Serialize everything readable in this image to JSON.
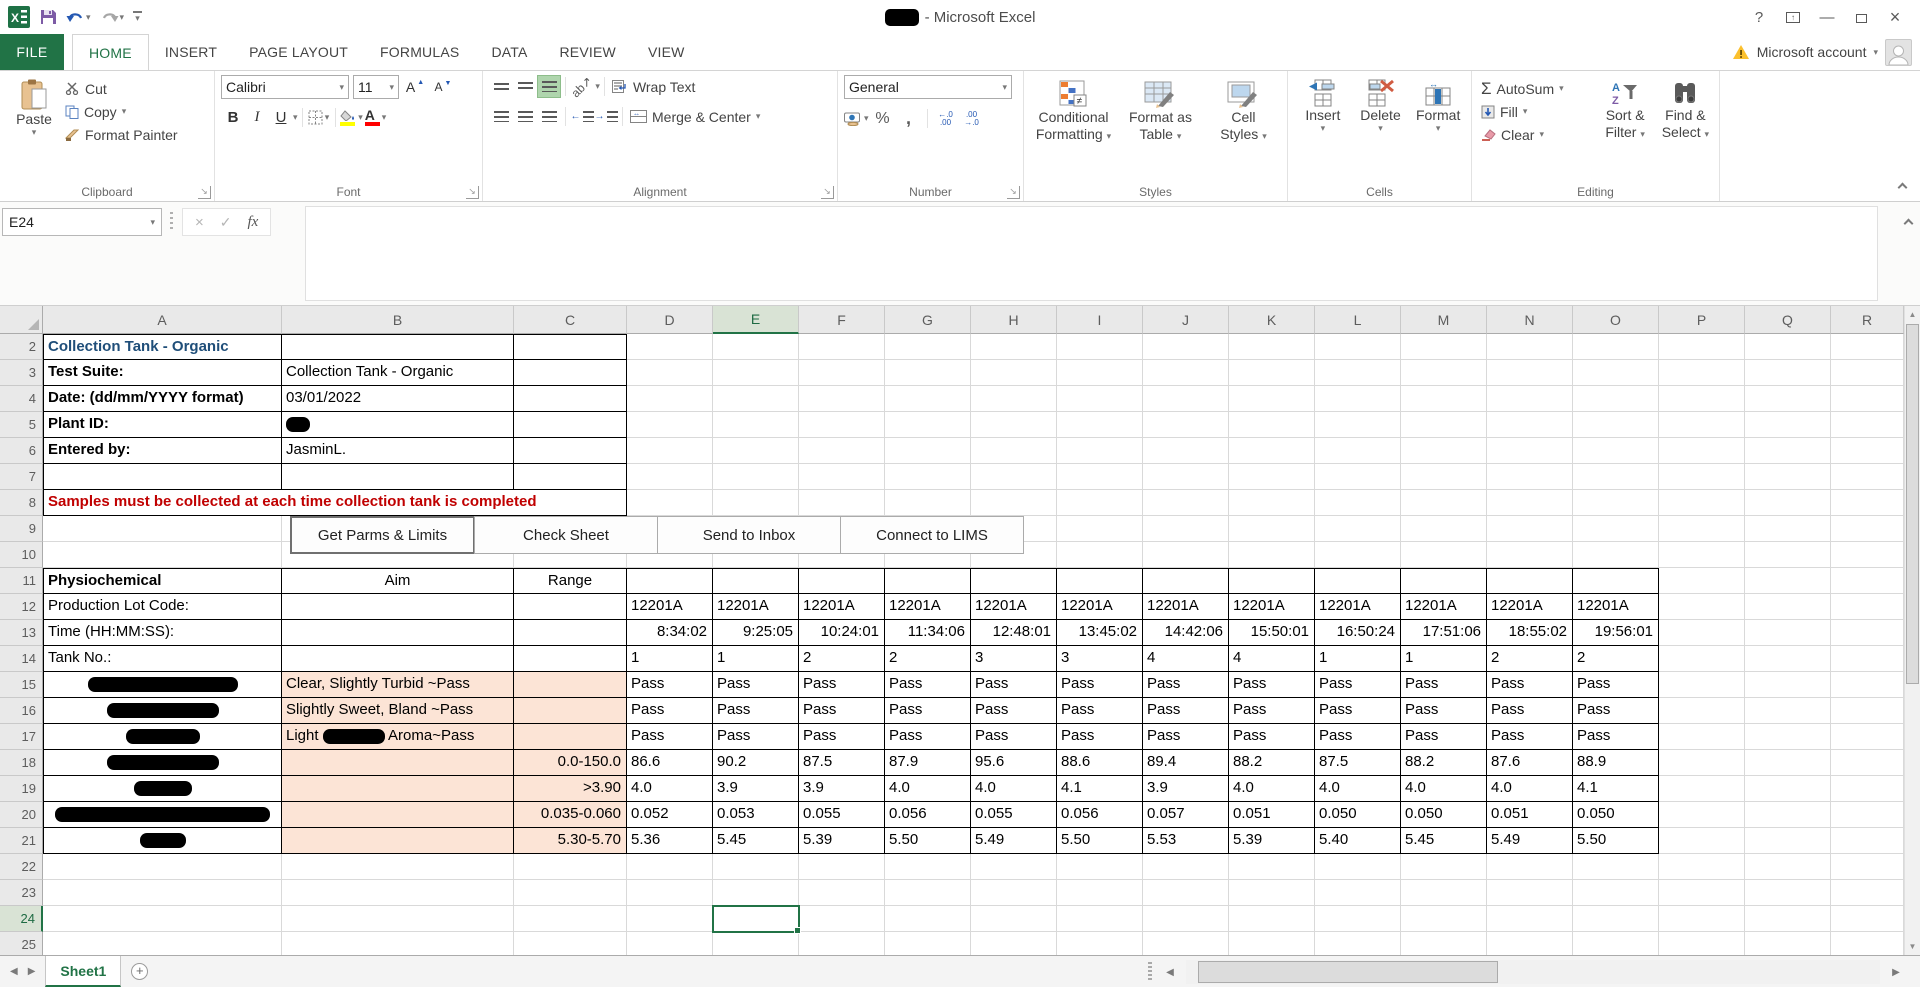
{
  "colors": {
    "accent_green": "#217346",
    "tan_fill": "#FCE4D6",
    "warning_red": "#C00000",
    "title_blue": "#1F4E79"
  },
  "window": {
    "title_suffix": " - Microsoft Excel",
    "title_redacted_width": 34
  },
  "ribbon": {
    "file_tab": "FILE",
    "tabs": [
      "HOME",
      "INSERT",
      "PAGE LAYOUT",
      "FORMULAS",
      "DATA",
      "REVIEW",
      "VIEW"
    ],
    "active_tab": "HOME",
    "account_label": "Microsoft account",
    "groups": {
      "clipboard": {
        "label": "Clipboard",
        "paste": "Paste",
        "cut": "Cut",
        "copy": "Copy",
        "format_painter": "Format Painter"
      },
      "font": {
        "label": "Font",
        "family": "Calibri",
        "size": "11",
        "bold": "B",
        "italic": "I",
        "underline": "U"
      },
      "alignment": {
        "label": "Alignment",
        "wrap_text": "Wrap Text",
        "merge_center": "Merge & Center"
      },
      "number": {
        "label": "Number",
        "format": "General"
      },
      "styles": {
        "label": "Styles",
        "conditional_1": "Conditional",
        "conditional_2": "Formatting",
        "table_1": "Format as",
        "table_2": "Table",
        "cellstyles_1": "Cell",
        "cellstyles_2": "Styles"
      },
      "cells": {
        "label": "Cells",
        "insert": "Insert",
        "delete": "Delete",
        "format": "Format"
      },
      "editing": {
        "label": "Editing",
        "autosum": "AutoSum",
        "fill": "Fill",
        "clear": "Clear",
        "sort_1": "Sort &",
        "sort_2": "Filter",
        "find_1": "Find &",
        "find_2": "Select"
      }
    }
  },
  "formula_bar": {
    "name_box": "E24",
    "fx": "fx"
  },
  "sheet": {
    "columns": [
      "A",
      "B",
      "C",
      "D",
      "E",
      "F",
      "G",
      "H",
      "I",
      "J",
      "K",
      "L",
      "M",
      "N",
      "O",
      "P",
      "Q",
      "R"
    ],
    "first_row": 2,
    "last_row": 25,
    "selected_column": "E",
    "selected_row": 24,
    "header_block": [
      {
        "row": 2,
        "a": "Collection Tank - Organic",
        "style": "title"
      },
      {
        "row": 3,
        "a": "Test Suite:",
        "b": "Collection Tank - Organic"
      },
      {
        "row": 4,
        "a": "Date: (dd/mm/YYYY format)",
        "b": "03/01/2022"
      },
      {
        "row": 5,
        "a": "Plant ID:",
        "b_redacted_width": 24
      },
      {
        "row": 6,
        "a": "Entered by:",
        "b": "JasminL."
      },
      {
        "row": 7,
        "a": ""
      }
    ],
    "warning_text": "Samples must be collected at each time collection tank is completed",
    "form_buttons": [
      "Get Parms & Limits",
      "Check Sheet",
      "Send to Inbox",
      "Connect to LIMS"
    ],
    "param_header": {
      "a": "Physiochemical",
      "b": "Aim",
      "c": "Range"
    },
    "data_rows": [
      {
        "row": 12,
        "label": "Production Lot Code:",
        "align": "left",
        "values": [
          "12201A",
          "12201A",
          "12201A",
          "12201A",
          "12201A",
          "12201A",
          "12201A",
          "12201A",
          "12201A",
          "12201A",
          "12201A",
          "12201A"
        ]
      },
      {
        "row": 13,
        "label": "Time (HH:MM:SS):",
        "align": "right",
        "values": [
          "8:34:02",
          "9:25:05",
          "10:24:01",
          "11:34:06",
          "12:48:01",
          "13:45:02",
          "14:42:06",
          "15:50:01",
          "16:50:24",
          "17:51:06",
          "18:55:02",
          "19:56:01"
        ]
      },
      {
        "row": 14,
        "label": "Tank No.:",
        "align": "left",
        "values": [
          "1",
          "1",
          "2",
          "2",
          "3",
          "3",
          "4",
          "4",
          "1",
          "1",
          "2",
          "2"
        ]
      },
      {
        "row": 15,
        "label_redacted_width": 150,
        "aim": "Clear, Slightly Turbid ~Pass",
        "range": "",
        "align": "left",
        "values": [
          "Pass",
          "Pass",
          "Pass",
          "Pass",
          "Pass",
          "Pass",
          "Pass",
          "Pass",
          "Pass",
          "Pass",
          "Pass",
          "Pass"
        ]
      },
      {
        "row": 16,
        "label_redacted_width": 112,
        "aim": "Slightly Sweet, Bland ~Pass",
        "range": "",
        "align": "left",
        "values": [
          "Pass",
          "Pass",
          "Pass",
          "Pass",
          "Pass",
          "Pass",
          "Pass",
          "Pass",
          "Pass",
          "Pass",
          "Pass",
          "Pass"
        ]
      },
      {
        "row": 17,
        "label_redacted_width": 74,
        "aim_prefix": "Light",
        "aim_redacted_width": 62,
        "aim_suffix": "Aroma~Pass",
        "range": "",
        "align": "left",
        "values": [
          "Pass",
          "Pass",
          "Pass",
          "Pass",
          "Pass",
          "Pass",
          "Pass",
          "Pass",
          "Pass",
          "Pass",
          "Pass",
          "Pass"
        ]
      },
      {
        "row": 18,
        "label_redacted_width": 112,
        "aim": "",
        "range": "0.0-150.0",
        "align": "left",
        "values": [
          "86.6",
          "90.2",
          "87.5",
          "87.9",
          "95.6",
          "88.6",
          "89.4",
          "88.2",
          "87.5",
          "88.2",
          "87.6",
          "88.9"
        ]
      },
      {
        "row": 19,
        "label_redacted_width": 58,
        "aim": "",
        "range": ">3.90",
        "align": "left",
        "values": [
          "4.0",
          "3.9",
          "3.9",
          "4.0",
          "4.0",
          "4.1",
          "3.9",
          "4.0",
          "4.0",
          "4.0",
          "4.0",
          "4.1"
        ]
      },
      {
        "row": 20,
        "label_redacted_width": 215,
        "aim": "",
        "range": "0.035-0.060",
        "align": "left",
        "values": [
          "0.052",
          "0.053",
          "0.055",
          "0.056",
          "0.055",
          "0.056",
          "0.057",
          "0.051",
          "0.050",
          "0.050",
          "0.051",
          "0.050"
        ]
      },
      {
        "row": 21,
        "label_redacted_width": 46,
        "aim": "",
        "range": "5.30-5.70",
        "align": "left",
        "values": [
          "5.36",
          "5.45",
          "5.39",
          "5.50",
          "5.49",
          "5.50",
          "5.53",
          "5.39",
          "5.40",
          "5.45",
          "5.49",
          "5.50"
        ]
      }
    ]
  },
  "sheet_bar": {
    "active_tab": "Sheet1"
  }
}
